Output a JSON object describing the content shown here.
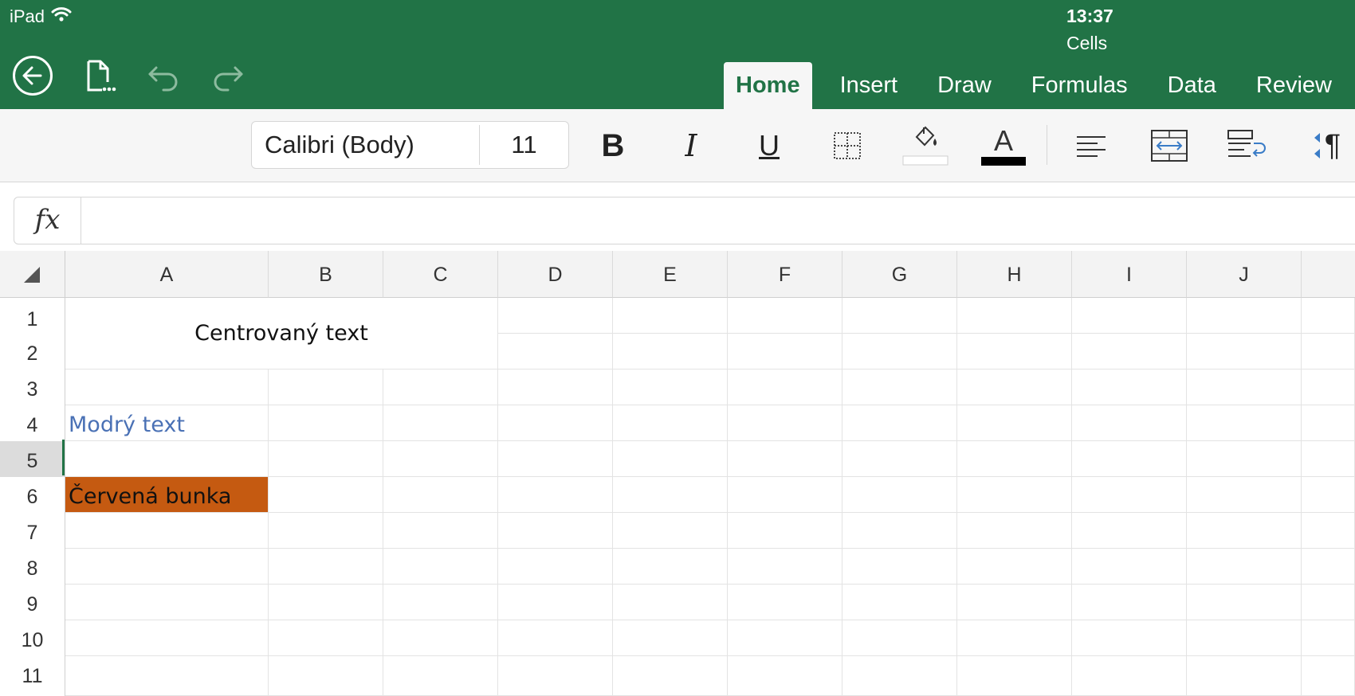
{
  "status": {
    "device": "iPad",
    "time": "13:37"
  },
  "document": {
    "title": "Cells"
  },
  "toolbar": {
    "back": "back-icon",
    "file": "file-icon",
    "undo": "undo-icon",
    "redo": "redo-icon"
  },
  "tabs": [
    {
      "label": "Home",
      "active": true
    },
    {
      "label": "Insert",
      "active": false
    },
    {
      "label": "Draw",
      "active": false
    },
    {
      "label": "Formulas",
      "active": false
    },
    {
      "label": "Data",
      "active": false
    },
    {
      "label": "Review",
      "active": false
    }
  ],
  "ribbon": {
    "font_name": "Calibri (Body)",
    "font_size": "11",
    "bold": "B",
    "italic": "I",
    "underline": "U",
    "font_color_glyph": "A",
    "fill_color": "#ffffff",
    "font_color": "#000000",
    "pilcrow": "¶"
  },
  "formula_bar": {
    "label": "fx",
    "value": ""
  },
  "sheet": {
    "columns": [
      "A",
      "B",
      "C",
      "D",
      "E",
      "F",
      "G",
      "H",
      "I",
      "J"
    ],
    "rows": [
      "1",
      "2",
      "3",
      "4",
      "5",
      "6",
      "7",
      "8",
      "9",
      "10",
      "11"
    ],
    "selected_row": "5",
    "cells": {
      "A1_C2": "Centrovaný text",
      "A4": "Modrý text",
      "A6": "Červená bunka"
    },
    "colors": {
      "accent": "#217346",
      "blue_text": "#4a71b5",
      "red_fill": "#c55a11"
    }
  }
}
